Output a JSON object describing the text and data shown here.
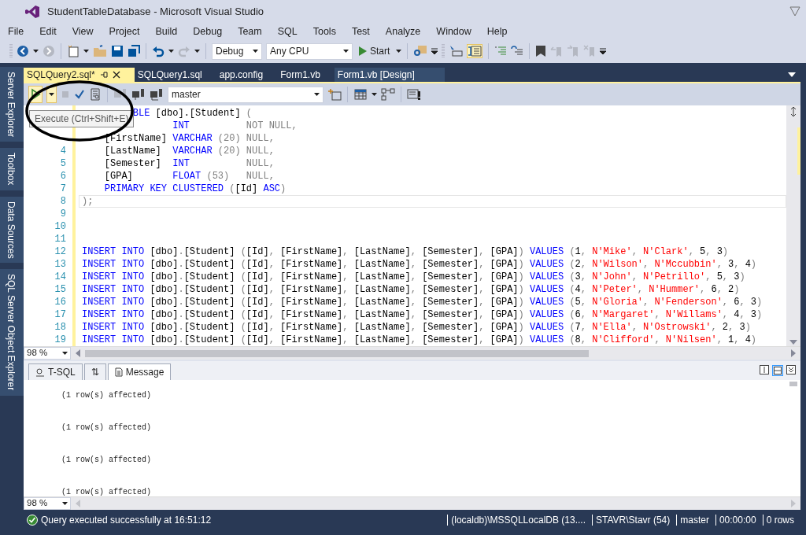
{
  "window": {
    "title": "StudentTableDatabase - Microsoft Visual Studio"
  },
  "menu": [
    "File",
    "Edit",
    "View",
    "Project",
    "Build",
    "Debug",
    "Team",
    "SQL",
    "Tools",
    "Test",
    "Analyze",
    "Window",
    "Help"
  ],
  "toolbar": {
    "configuration": "Debug",
    "platform": "Any CPU",
    "start": "Start"
  },
  "side_tabs": [
    "Server Explorer",
    "Toolbox",
    "Data Sources",
    "SQL Server Object Explorer"
  ],
  "doc_tabs": [
    {
      "label": "SQLQuery2.sql*",
      "selected": true
    },
    {
      "label": "SQLQuery1.sql",
      "selected": false
    },
    {
      "label": "app.config",
      "selected": false
    },
    {
      "label": "Form1.vb",
      "selected": false
    },
    {
      "label": "Form1.vb [Design]",
      "selected": false
    }
  ],
  "sql_toolbar": {
    "database": "master",
    "tooltip": "Execute (Ctrl+Shift+E)"
  },
  "editor": {
    "zoom": "98 %",
    "lines": [
      {
        "current": false,
        "segments": [
          {
            "kind": "kw",
            "text": "         BLE"
          },
          {
            "kind": "id",
            "text": " [dbo].[Student] "
          },
          {
            "kind": "op",
            "text": "("
          }
        ]
      },
      {
        "current": false,
        "segments": [
          {
            "kind": "kw",
            "text": "                INT"
          },
          {
            "kind": "op",
            "text": "          NOT NULL,"
          }
        ]
      },
      {
        "current": false,
        "segments": [
          {
            "kind": "id",
            "text": "    [FirstName]"
          },
          {
            "kind": "kw",
            "text": " VARCHAR"
          },
          {
            "kind": "op",
            "text": " (20) NULL,"
          }
        ]
      },
      {
        "number": "4",
        "current": false,
        "segments": [
          {
            "kind": "id",
            "text": "    [LastName]"
          },
          {
            "kind": "kw",
            "text": "  VARCHAR"
          },
          {
            "kind": "op",
            "text": " (20) NULL,"
          }
        ]
      },
      {
        "number": "5",
        "current": false,
        "segments": [
          {
            "kind": "id",
            "text": "    [Semester]"
          },
          {
            "kind": "kw",
            "text": "  INT"
          },
          {
            "kind": "op",
            "text": "          NULL,"
          }
        ]
      },
      {
        "number": "6",
        "current": false,
        "segments": [
          {
            "kind": "id",
            "text": "    [GPA]"
          },
          {
            "kind": "kw",
            "text": "       FLOAT"
          },
          {
            "kind": "op",
            "text": " (53)   NULL,"
          }
        ]
      },
      {
        "number": "7",
        "current": false,
        "segments": [
          {
            "kind": "kw",
            "text": "    PRIMARY KEY CLUSTERED"
          },
          {
            "kind": "op",
            "text": " ("
          },
          {
            "kind": "id",
            "text": "[Id]"
          },
          {
            "kind": "kw",
            "text": " ASC"
          },
          {
            "kind": "op",
            "text": ")"
          }
        ]
      },
      {
        "number": "8",
        "current": true,
        "segments": [
          {
            "kind": "op",
            "text": ");"
          }
        ]
      },
      {
        "number": "9",
        "current": false
      },
      {
        "number": "10",
        "current": false
      },
      {
        "number": "11",
        "current": false
      },
      {
        "number": "12",
        "current": false,
        "segments": [
          {
            "kind": "kw",
            "text": "INSERT INTO"
          },
          {
            "kind": "id",
            "text": " [dbo]"
          },
          {
            "kind": "op",
            "text": "."
          },
          {
            "kind": "id",
            "text": "[Student] "
          },
          {
            "kind": "op",
            "text": "("
          },
          {
            "kind": "id",
            "text": "[Id]"
          },
          {
            "kind": "op",
            "text": ", "
          },
          {
            "kind": "id",
            "text": "[FirstName]"
          },
          {
            "kind": "op",
            "text": ", "
          },
          {
            "kind": "id",
            "text": "[LastName]"
          },
          {
            "kind": "op",
            "text": ", "
          },
          {
            "kind": "id",
            "text": "[Semester]"
          },
          {
            "kind": "op",
            "text": ", "
          },
          {
            "kind": "id",
            "text": "[GPA]"
          },
          {
            "kind": "op",
            "text": ") "
          },
          {
            "kind": "kw",
            "text": "VALUES"
          },
          {
            "kind": "op",
            "text": " ("
          },
          {
            "kind": "id",
            "text": "1"
          },
          {
            "kind": "op",
            "text": ", "
          },
          {
            "kind": "str",
            "text": "N'Mike'"
          },
          {
            "kind": "op",
            "text": ", "
          },
          {
            "kind": "str",
            "text": "N'Clark'"
          },
          {
            "kind": "op",
            "text": ", "
          },
          {
            "kind": "id",
            "text": "5"
          },
          {
            "kind": "op",
            "text": ", "
          },
          {
            "kind": "id",
            "text": "3"
          },
          {
            "kind": "op",
            "text": ")"
          }
        ]
      },
      {
        "number": "13",
        "current": false,
        "segments": [
          {
            "kind": "kw",
            "text": "INSERT INTO"
          },
          {
            "kind": "id",
            "text": " [dbo]"
          },
          {
            "kind": "op",
            "text": "."
          },
          {
            "kind": "id",
            "text": "[Student] "
          },
          {
            "kind": "op",
            "text": "("
          },
          {
            "kind": "id",
            "text": "[Id]"
          },
          {
            "kind": "op",
            "text": ", "
          },
          {
            "kind": "id",
            "text": "[FirstName]"
          },
          {
            "kind": "op",
            "text": ", "
          },
          {
            "kind": "id",
            "text": "[LastName]"
          },
          {
            "kind": "op",
            "text": ", "
          },
          {
            "kind": "id",
            "text": "[Semester]"
          },
          {
            "kind": "op",
            "text": ", "
          },
          {
            "kind": "id",
            "text": "[GPA]"
          },
          {
            "kind": "op",
            "text": ") "
          },
          {
            "kind": "kw",
            "text": "VALUES"
          },
          {
            "kind": "op",
            "text": " ("
          },
          {
            "kind": "id",
            "text": "2"
          },
          {
            "kind": "op",
            "text": ", "
          },
          {
            "kind": "str",
            "text": "N'Wilson'"
          },
          {
            "kind": "op",
            "text": ", "
          },
          {
            "kind": "str",
            "text": "N'Mccubbin'"
          },
          {
            "kind": "op",
            "text": ", "
          },
          {
            "kind": "id",
            "text": "3"
          },
          {
            "kind": "op",
            "text": ", "
          },
          {
            "kind": "id",
            "text": "4"
          },
          {
            "kind": "op",
            "text": ")"
          }
        ]
      },
      {
        "number": "14",
        "current": false,
        "segments": [
          {
            "kind": "kw",
            "text": "INSERT INTO"
          },
          {
            "kind": "id",
            "text": " [dbo]"
          },
          {
            "kind": "op",
            "text": "."
          },
          {
            "kind": "id",
            "text": "[Student] "
          },
          {
            "kind": "op",
            "text": "("
          },
          {
            "kind": "id",
            "text": "[Id]"
          },
          {
            "kind": "op",
            "text": ", "
          },
          {
            "kind": "id",
            "text": "[FirstName]"
          },
          {
            "kind": "op",
            "text": ", "
          },
          {
            "kind": "id",
            "text": "[LastName]"
          },
          {
            "kind": "op",
            "text": ", "
          },
          {
            "kind": "id",
            "text": "[Semester]"
          },
          {
            "kind": "op",
            "text": ", "
          },
          {
            "kind": "id",
            "text": "[GPA]"
          },
          {
            "kind": "op",
            "text": ") "
          },
          {
            "kind": "kw",
            "text": "VALUES"
          },
          {
            "kind": "op",
            "text": " ("
          },
          {
            "kind": "id",
            "text": "3"
          },
          {
            "kind": "op",
            "text": ", "
          },
          {
            "kind": "str",
            "text": "N'John'"
          },
          {
            "kind": "op",
            "text": ", "
          },
          {
            "kind": "str",
            "text": "N'Petrillo'"
          },
          {
            "kind": "op",
            "text": ", "
          },
          {
            "kind": "id",
            "text": "5"
          },
          {
            "kind": "op",
            "text": ", "
          },
          {
            "kind": "id",
            "text": "3"
          },
          {
            "kind": "op",
            "text": ")"
          }
        ]
      },
      {
        "number": "15",
        "current": false,
        "segments": [
          {
            "kind": "kw",
            "text": "INSERT INTO"
          },
          {
            "kind": "id",
            "text": " [dbo]"
          },
          {
            "kind": "op",
            "text": "."
          },
          {
            "kind": "id",
            "text": "[Student] "
          },
          {
            "kind": "op",
            "text": "("
          },
          {
            "kind": "id",
            "text": "[Id]"
          },
          {
            "kind": "op",
            "text": ", "
          },
          {
            "kind": "id",
            "text": "[FirstName]"
          },
          {
            "kind": "op",
            "text": ", "
          },
          {
            "kind": "id",
            "text": "[LastName]"
          },
          {
            "kind": "op",
            "text": ", "
          },
          {
            "kind": "id",
            "text": "[Semester]"
          },
          {
            "kind": "op",
            "text": ", "
          },
          {
            "kind": "id",
            "text": "[GPA]"
          },
          {
            "kind": "op",
            "text": ") "
          },
          {
            "kind": "kw",
            "text": "VALUES"
          },
          {
            "kind": "op",
            "text": " ("
          },
          {
            "kind": "id",
            "text": "4"
          },
          {
            "kind": "op",
            "text": ", "
          },
          {
            "kind": "str",
            "text": "N'Peter'"
          },
          {
            "kind": "op",
            "text": ", "
          },
          {
            "kind": "str",
            "text": "N'Hummer'"
          },
          {
            "kind": "op",
            "text": ", "
          },
          {
            "kind": "id",
            "text": "6"
          },
          {
            "kind": "op",
            "text": ", "
          },
          {
            "kind": "id",
            "text": "2"
          },
          {
            "kind": "op",
            "text": ")"
          }
        ]
      },
      {
        "number": "16",
        "current": false,
        "segments": [
          {
            "kind": "kw",
            "text": "INSERT INTO"
          },
          {
            "kind": "id",
            "text": " [dbo]"
          },
          {
            "kind": "op",
            "text": "."
          },
          {
            "kind": "id",
            "text": "[Student] "
          },
          {
            "kind": "op",
            "text": "("
          },
          {
            "kind": "id",
            "text": "[Id]"
          },
          {
            "kind": "op",
            "text": ", "
          },
          {
            "kind": "id",
            "text": "[FirstName]"
          },
          {
            "kind": "op",
            "text": ", "
          },
          {
            "kind": "id",
            "text": "[LastName]"
          },
          {
            "kind": "op",
            "text": ", "
          },
          {
            "kind": "id",
            "text": "[Semester]"
          },
          {
            "kind": "op",
            "text": ", "
          },
          {
            "kind": "id",
            "text": "[GPA]"
          },
          {
            "kind": "op",
            "text": ") "
          },
          {
            "kind": "kw",
            "text": "VALUES"
          },
          {
            "kind": "op",
            "text": " ("
          },
          {
            "kind": "id",
            "text": "5"
          },
          {
            "kind": "op",
            "text": ", "
          },
          {
            "kind": "str",
            "text": "N'Gloria'"
          },
          {
            "kind": "op",
            "text": ", "
          },
          {
            "kind": "str",
            "text": "N'Fenderson'"
          },
          {
            "kind": "op",
            "text": ", "
          },
          {
            "kind": "id",
            "text": "6"
          },
          {
            "kind": "op",
            "text": ", "
          },
          {
            "kind": "id",
            "text": "3"
          },
          {
            "kind": "op",
            "text": ")"
          }
        ]
      },
      {
        "number": "17",
        "current": false,
        "segments": [
          {
            "kind": "kw",
            "text": "INSERT INTO"
          },
          {
            "kind": "id",
            "text": " [dbo]"
          },
          {
            "kind": "op",
            "text": "."
          },
          {
            "kind": "id",
            "text": "[Student] "
          },
          {
            "kind": "op",
            "text": "("
          },
          {
            "kind": "id",
            "text": "[Id]"
          },
          {
            "kind": "op",
            "text": ", "
          },
          {
            "kind": "id",
            "text": "[FirstName]"
          },
          {
            "kind": "op",
            "text": ", "
          },
          {
            "kind": "id",
            "text": "[LastName]"
          },
          {
            "kind": "op",
            "text": ", "
          },
          {
            "kind": "id",
            "text": "[Semester]"
          },
          {
            "kind": "op",
            "text": ", "
          },
          {
            "kind": "id",
            "text": "[GPA]"
          },
          {
            "kind": "op",
            "text": ") "
          },
          {
            "kind": "kw",
            "text": "VALUES"
          },
          {
            "kind": "op",
            "text": " ("
          },
          {
            "kind": "id",
            "text": "6"
          },
          {
            "kind": "op",
            "text": ", "
          },
          {
            "kind": "str",
            "text": "N'Margaret'"
          },
          {
            "kind": "op",
            "text": ", "
          },
          {
            "kind": "str",
            "text": "N'Willams'"
          },
          {
            "kind": "op",
            "text": ", "
          },
          {
            "kind": "id",
            "text": "4"
          },
          {
            "kind": "op",
            "text": ", "
          },
          {
            "kind": "id",
            "text": "3"
          },
          {
            "kind": "op",
            "text": ")"
          }
        ]
      },
      {
        "number": "18",
        "current": false,
        "segments": [
          {
            "kind": "kw",
            "text": "INSERT INTO"
          },
          {
            "kind": "id",
            "text": " [dbo]"
          },
          {
            "kind": "op",
            "text": "."
          },
          {
            "kind": "id",
            "text": "[Student] "
          },
          {
            "kind": "op",
            "text": "("
          },
          {
            "kind": "id",
            "text": "[Id]"
          },
          {
            "kind": "op",
            "text": ", "
          },
          {
            "kind": "id",
            "text": "[FirstName]"
          },
          {
            "kind": "op",
            "text": ", "
          },
          {
            "kind": "id",
            "text": "[LastName]"
          },
          {
            "kind": "op",
            "text": ", "
          },
          {
            "kind": "id",
            "text": "[Semester]"
          },
          {
            "kind": "op",
            "text": ", "
          },
          {
            "kind": "id",
            "text": "[GPA]"
          },
          {
            "kind": "op",
            "text": ") "
          },
          {
            "kind": "kw",
            "text": "VALUES"
          },
          {
            "kind": "op",
            "text": " ("
          },
          {
            "kind": "id",
            "text": "7"
          },
          {
            "kind": "op",
            "text": ", "
          },
          {
            "kind": "str",
            "text": "N'Ella'"
          },
          {
            "kind": "op",
            "text": ", "
          },
          {
            "kind": "str",
            "text": "N'Ostrowski'"
          },
          {
            "kind": "op",
            "text": ", "
          },
          {
            "kind": "id",
            "text": "2"
          },
          {
            "kind": "op",
            "text": ", "
          },
          {
            "kind": "id",
            "text": "3"
          },
          {
            "kind": "op",
            "text": ")"
          }
        ]
      },
      {
        "number": "19",
        "current": false,
        "segments": [
          {
            "kind": "kw",
            "text": "INSERT INTO"
          },
          {
            "kind": "id",
            "text": " [dbo]"
          },
          {
            "kind": "op",
            "text": "."
          },
          {
            "kind": "id",
            "text": "[Student] "
          },
          {
            "kind": "op",
            "text": "("
          },
          {
            "kind": "id",
            "text": "[Id]"
          },
          {
            "kind": "op",
            "text": ", "
          },
          {
            "kind": "id",
            "text": "[FirstName]"
          },
          {
            "kind": "op",
            "text": ", "
          },
          {
            "kind": "id",
            "text": "[LastName]"
          },
          {
            "kind": "op",
            "text": ", "
          },
          {
            "kind": "id",
            "text": "[Semester]"
          },
          {
            "kind": "op",
            "text": ", "
          },
          {
            "kind": "id",
            "text": "[GPA]"
          },
          {
            "kind": "op",
            "text": ") "
          },
          {
            "kind": "kw",
            "text": "VALUES"
          },
          {
            "kind": "op",
            "text": " ("
          },
          {
            "kind": "id",
            "text": "8"
          },
          {
            "kind": "op",
            "text": ", "
          },
          {
            "kind": "str",
            "text": "N'Clifford'"
          },
          {
            "kind": "op",
            "text": ", "
          },
          {
            "kind": "str",
            "text": "N'Nilsen'"
          },
          {
            "kind": "op",
            "text": ", "
          },
          {
            "kind": "id",
            "text": "1"
          },
          {
            "kind": "op",
            "text": ", "
          },
          {
            "kind": "id",
            "text": "4"
          },
          {
            "kind": "op",
            "text": ")"
          }
        ]
      }
    ]
  },
  "results": {
    "tabs": [
      {
        "label": "T-SQL",
        "selected": false
      },
      {
        "label": "⇅",
        "selected": false
      },
      {
        "label": "Message",
        "selected": true
      }
    ],
    "messages": [
      "(1 row(s) affected)",
      "(1 row(s) affected)",
      "(1 row(s) affected)",
      "(1 row(s) affected)"
    ],
    "zoom": "98 %"
  },
  "status_bar": {
    "message": "Query executed successfully at 16:51:12",
    "fields": [
      "(localdb)\\MSSQLLocalDB (13....",
      "STAVR\\Stavr (54)",
      "master",
      "00:00:00",
      "0 rows"
    ]
  }
}
